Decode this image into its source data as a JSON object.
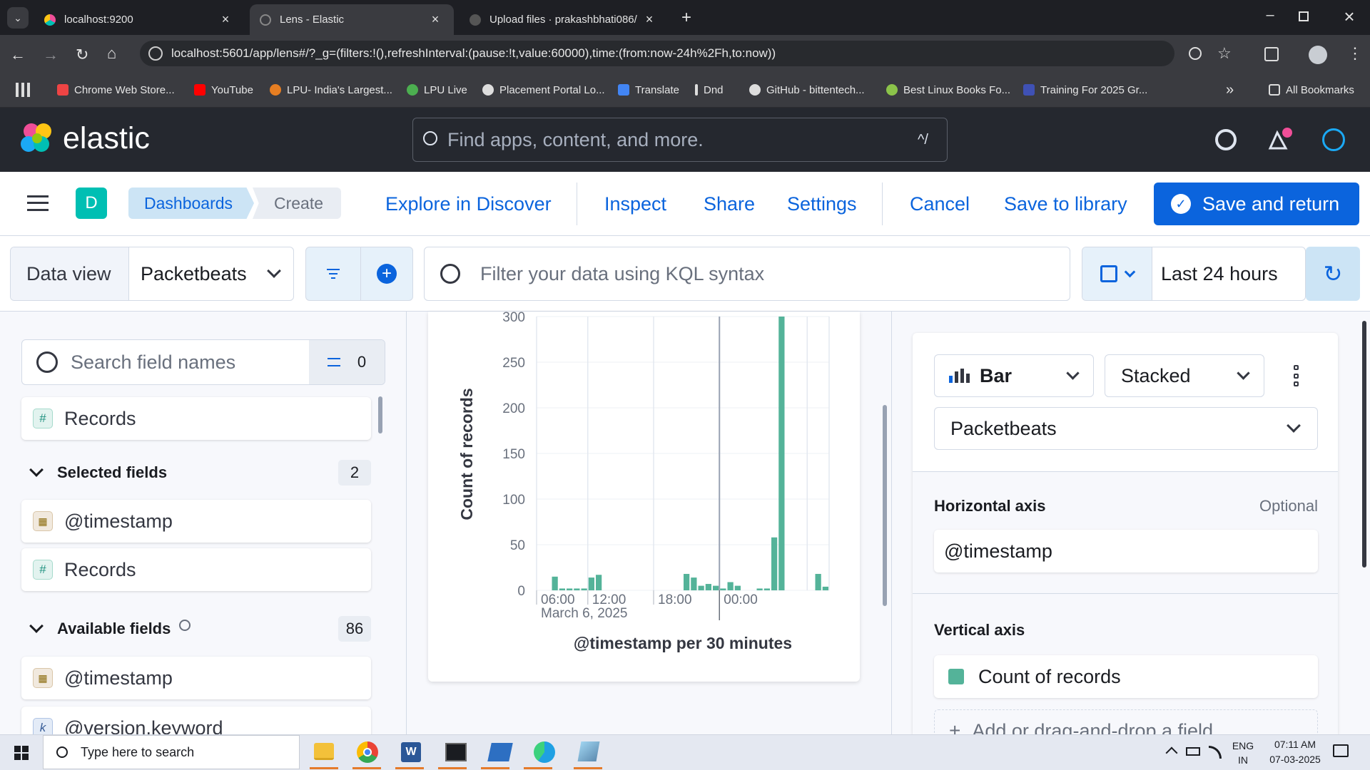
{
  "browser": {
    "tabs": [
      {
        "title": "localhost:9200",
        "active": false
      },
      {
        "title": "Lens - Elastic",
        "active": true
      },
      {
        "title": "Upload files · prakashbhati086/",
        "active": false
      }
    ],
    "url": "localhost:5601/app/lens#/?_g=(filters:!(),refreshInterval:(pause:!t,value:60000),time:(from:now-24h%2Fh,to:now))",
    "bookmarks": [
      "Chrome Web Store...",
      "YouTube",
      "LPU- India's Largest...",
      "LPU Live",
      "Placement Portal Lo...",
      "Translate",
      "Dnd",
      "GitHub - bittentech...",
      "Best Linux Books Fo...",
      "Training For 2025 Gr..."
    ],
    "all_bookmarks": "All Bookmarks"
  },
  "kibana": {
    "brand": "elastic",
    "global_search_placeholder": "Find apps, content, and more.",
    "search_shortcut": "^/",
    "space_initial": "D",
    "breadcrumbs": [
      "Dashboards",
      "Create"
    ],
    "actions": [
      "Explore in Discover",
      "Inspect",
      "Share",
      "Settings",
      "Cancel",
      "Save to library"
    ],
    "primary_action": "Save and return",
    "data_view_label": "Data view",
    "data_view_value": "Packetbeats",
    "query_placeholder": "Filter your data using KQL syntax",
    "time_range": "Last 24 hours"
  },
  "field_list": {
    "search_placeholder": "Search field names",
    "filter_count": "0",
    "records_label": "Records",
    "selected_title": "Selected fields",
    "selected_count": "2",
    "selected": [
      {
        "type": "date",
        "name": "@timestamp"
      },
      {
        "type": "number",
        "name": "Records"
      }
    ],
    "available_title": "Available fields",
    "available_count": "86",
    "available": [
      {
        "type": "date",
        "name": "@timestamp"
      },
      {
        "type": "keyword",
        "name": "@version.keyword"
      }
    ]
  },
  "config": {
    "chart_type": "Bar",
    "stack_mode": "Stacked",
    "layer_data_view": "Packetbeats",
    "horizontal_axis_title": "Horizontal axis",
    "optional_label": "Optional",
    "horizontal_field": "@timestamp",
    "vertical_axis_title": "Vertical axis",
    "vertical_field": "Count of records",
    "add_field": "Add or drag-and-drop a field",
    "series_color": "#54b399"
  },
  "chart_data": {
    "type": "bar",
    "ylabel": "Count of records",
    "xlabel": "@timestamp per 30 minutes",
    "ylim": [
      0,
      300
    ],
    "yticks": [
      0,
      50,
      100,
      150,
      200,
      250,
      300
    ],
    "xticks": [
      "06:00",
      "12:00",
      "18:00",
      "00:00"
    ],
    "x_date_label": "March 6, 2025",
    "color": "#54b399",
    "bars": [
      {
        "t": 1.0,
        "v": 15
      },
      {
        "t": 1.5,
        "v": 2
      },
      {
        "t": 2.0,
        "v": 2
      },
      {
        "t": 2.5,
        "v": 2
      },
      {
        "t": 3.0,
        "v": 2
      },
      {
        "t": 3.5,
        "v": 14
      },
      {
        "t": 4.0,
        "v": 17
      },
      {
        "t": 10.0,
        "v": 18
      },
      {
        "t": 10.5,
        "v": 14
      },
      {
        "t": 11.0,
        "v": 5
      },
      {
        "t": 11.5,
        "v": 7
      },
      {
        "t": 12.0,
        "v": 5
      },
      {
        "t": 12.5,
        "v": 2
      },
      {
        "t": 13.0,
        "v": 9
      },
      {
        "t": 13.5,
        "v": 5
      },
      {
        "t": 15.0,
        "v": 2
      },
      {
        "t": 15.5,
        "v": 2
      },
      {
        "t": 16.0,
        "v": 58
      },
      {
        "t": 16.5,
        "v": 300
      },
      {
        "t": 19.0,
        "v": 18
      },
      {
        "t": 19.5,
        "v": 4
      }
    ]
  },
  "taskbar": {
    "search_placeholder": "Type here to search",
    "lang": "ENG",
    "region": "IN",
    "time": "07:11 AM",
    "date": "07-03-2025"
  }
}
